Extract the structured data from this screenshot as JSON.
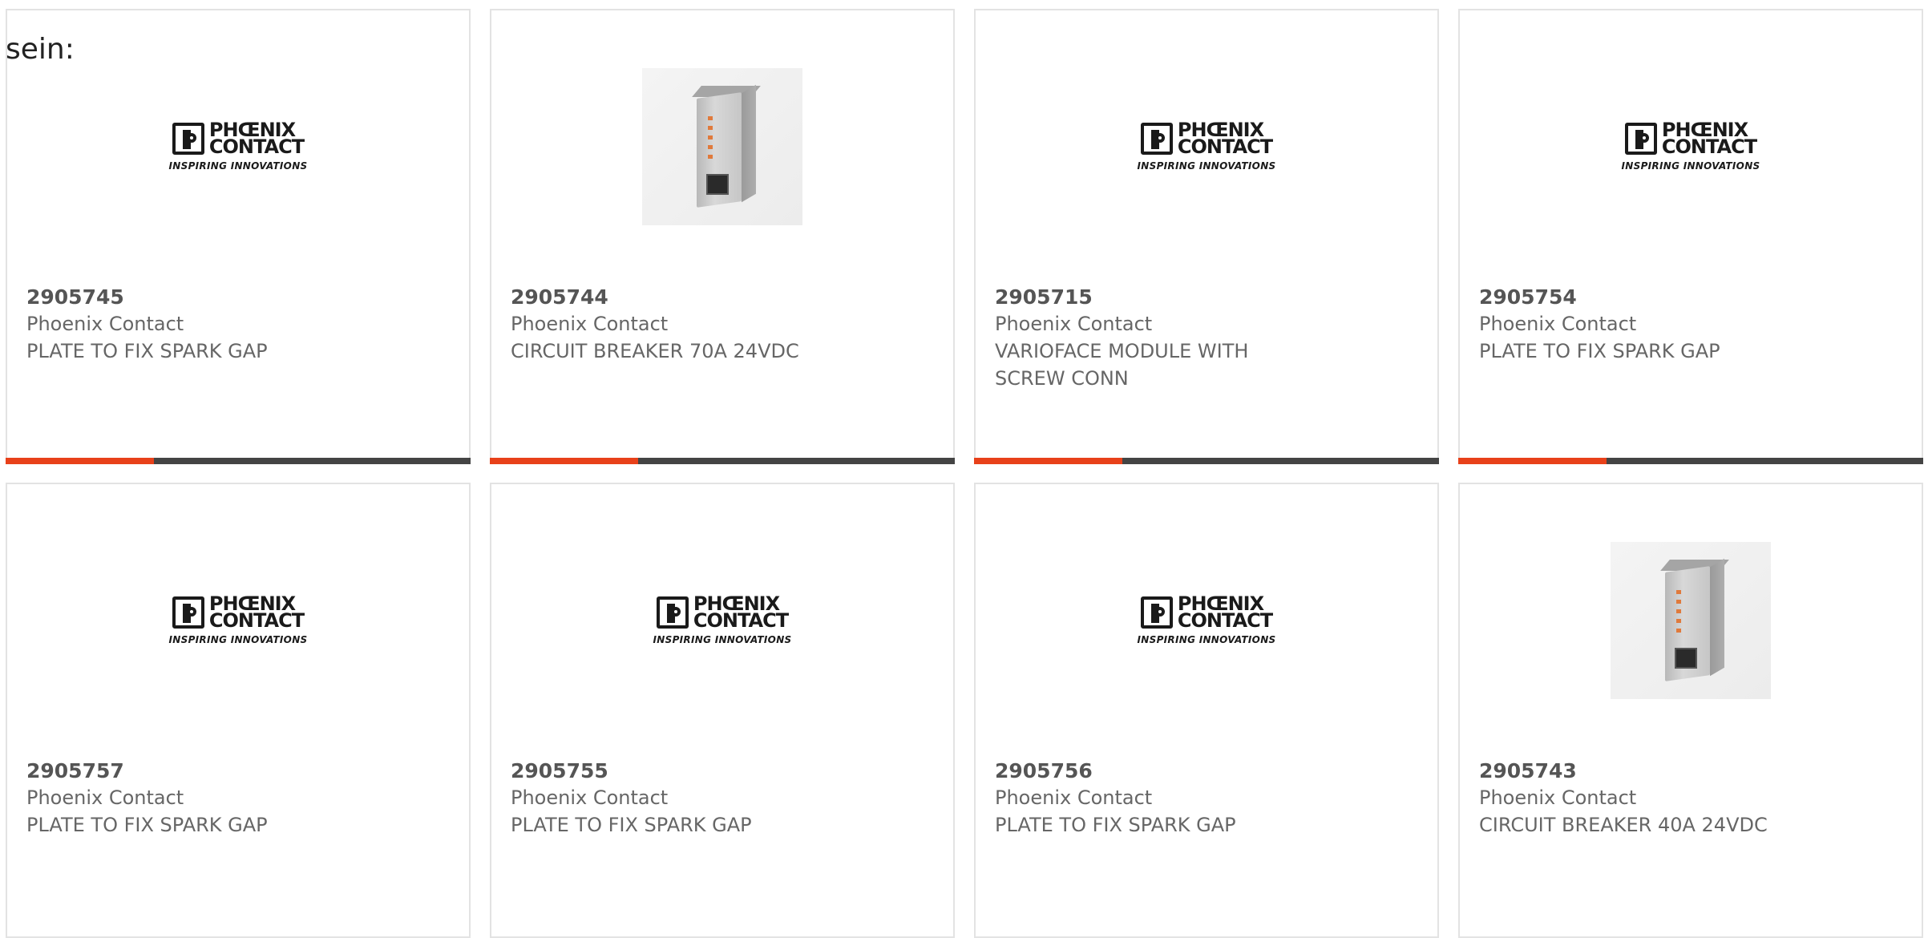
{
  "intro_text": "sein:",
  "logo": {
    "line1": "PHŒNIX",
    "line2": "CONTACT",
    "tagline": "INSPIRING INNOVATIONS"
  },
  "colors": {
    "accent": "#e8411a",
    "bar": "#444444",
    "text": "#666666",
    "number": "#555555"
  },
  "products": [
    {
      "number": "2905745",
      "manufacturer": "Phoenix Contact",
      "description": "PLATE TO FIX SPARK GAP",
      "image": "phoenix-logo"
    },
    {
      "number": "2905744",
      "manufacturer": "Phoenix Contact",
      "description": "CIRCUIT BREAKER 70A 24VDC",
      "image": "device-photo"
    },
    {
      "number": "2905715",
      "manufacturer": "Phoenix Contact",
      "description": "VARIOFACE MODULE WITH SCREW CONN",
      "image": "phoenix-logo"
    },
    {
      "number": "2905754",
      "manufacturer": "Phoenix Contact",
      "description": "PLATE TO FIX SPARK GAP",
      "image": "phoenix-logo"
    },
    {
      "number": "2905757",
      "manufacturer": "Phoenix Contact",
      "description": "PLATE TO FIX SPARK GAP",
      "image": "phoenix-logo"
    },
    {
      "number": "2905755",
      "manufacturer": "Phoenix Contact",
      "description": "PLATE TO FIX SPARK GAP",
      "image": "phoenix-logo"
    },
    {
      "number": "2905756",
      "manufacturer": "Phoenix Contact",
      "description": "PLATE TO FIX SPARK GAP",
      "image": "phoenix-logo"
    },
    {
      "number": "2905743",
      "manufacturer": "Phoenix Contact",
      "description": "CIRCUIT BREAKER 40A 24VDC",
      "image": "device-photo"
    }
  ]
}
